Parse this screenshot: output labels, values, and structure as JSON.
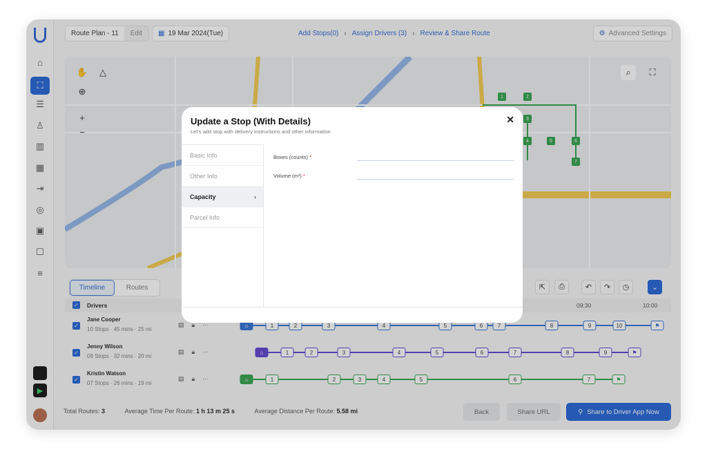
{
  "topbar": {
    "plan_name": "Route Plan - 11",
    "edit_label": "Edit",
    "date": "19 Mar 2024(Tue)",
    "steps": [
      "Add Stops(0)",
      "Assign Drivers (3)",
      "Review & Share Route"
    ],
    "advanced_settings": "Advanced Settings"
  },
  "sidebar": {
    "icons": [
      "home-icon",
      "map-route-icon",
      "list-icon",
      "users-icon",
      "analytics-icon",
      "calendar-icon",
      "import-icon",
      "location-icon",
      "contacts-icon",
      "chat-icon",
      "message-icon"
    ]
  },
  "map": {
    "markers": [
      "1",
      "2",
      "3",
      "4",
      "5",
      "6",
      "7"
    ]
  },
  "timeline": {
    "tabs": [
      "Timeline",
      "Routes"
    ],
    "drivers_header": "Drivers",
    "times": [
      "09:30",
      "10:00"
    ],
    "drivers": [
      {
        "name": "Jane Cooper",
        "meta": "10 Stops  · 45 mins  · 25 mi",
        "color": "#2f6fd0",
        "stops": [
          "1",
          "2",
          "3",
          "4",
          "5",
          "6",
          "7",
          "8",
          "9",
          "10"
        ]
      },
      {
        "name": "Jenny Wilson",
        "meta": "09 Stops  · 32 mins  · 20 mi",
        "color": "#5a3fd0",
        "stops": [
          "1",
          "2",
          "3",
          "4",
          "5",
          "6",
          "7",
          "8",
          "9"
        ]
      },
      {
        "name": "Kristin Watson",
        "meta": "07 Stops  · 26 mins  · 19 mi",
        "color": "#2fa04a",
        "stops": [
          "1",
          "2",
          "3",
          "4",
          "5",
          "6",
          "7"
        ]
      }
    ]
  },
  "footer": {
    "total_routes_label": "Total Routes:",
    "total_routes": "3",
    "avg_time_label": "Average Time Per Route:",
    "avg_time": "1 h 13 m 25 s",
    "avg_dist_label": "Average Distance Per Route:",
    "avg_dist": "5.58 mi",
    "back": "Back",
    "share_url": "Share URL",
    "share_driver": "Share to Driver App Now"
  },
  "modal": {
    "title": "Update a Stop (With Details)",
    "subtitle": "Let's add stop with delivery instructions and other information",
    "nav": [
      "Basic Info",
      "Other Info",
      "Capacity",
      "Parcel Info"
    ],
    "active_nav": "Capacity",
    "fields": [
      {
        "label": "Boxes (counts)",
        "required": "*",
        "value": ""
      },
      {
        "label": "Volume (m³)",
        "required": "*",
        "value": ""
      }
    ]
  }
}
